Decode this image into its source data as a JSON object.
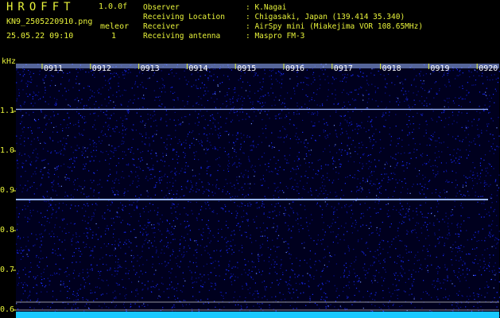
{
  "app": {
    "title": "HROFFT",
    "version": "1.0.0f"
  },
  "file": {
    "name": "KN9_2505220910.png",
    "datetime": "25.05.22 09:10"
  },
  "mode": {
    "label": "meleor",
    "value": "1"
  },
  "info": [
    {
      "key": "Observer",
      "value": ": K.Nagai"
    },
    {
      "key": "Receiving Location",
      "value": ": Chigasaki, Japan (139.414 35.340)"
    },
    {
      "key": "Receiver",
      "value": ": AirSpy mini (Miakejima VOR 108.65MHz)"
    },
    {
      "key": "Receiving antenna",
      "value": ": Maspro FM-3"
    }
  ],
  "chart_data": {
    "type": "heatmap",
    "ylabel": "kHz",
    "ylim": [
      0.58,
      1.22
    ],
    "y_ticks": [
      1.1,
      1.0,
      0.9,
      0.8,
      0.7,
      0.6
    ],
    "time_ticks": [
      "0911",
      "0912",
      "0913",
      "0914",
      "0915",
      "0916",
      "0917",
      "0918",
      "0919",
      "0920"
    ],
    "carriers_khz": [
      1.105,
      0.878
    ],
    "reference_lines_khz": [
      0.62,
      0.6
    ]
  },
  "colors": {
    "label": "#e7f23a",
    "background": "#000000",
    "noise_dark": "#000033",
    "noise_blue": "#1a2cff",
    "carrier": "#9ab8ff",
    "bottom_band": "#18c8ff"
  }
}
